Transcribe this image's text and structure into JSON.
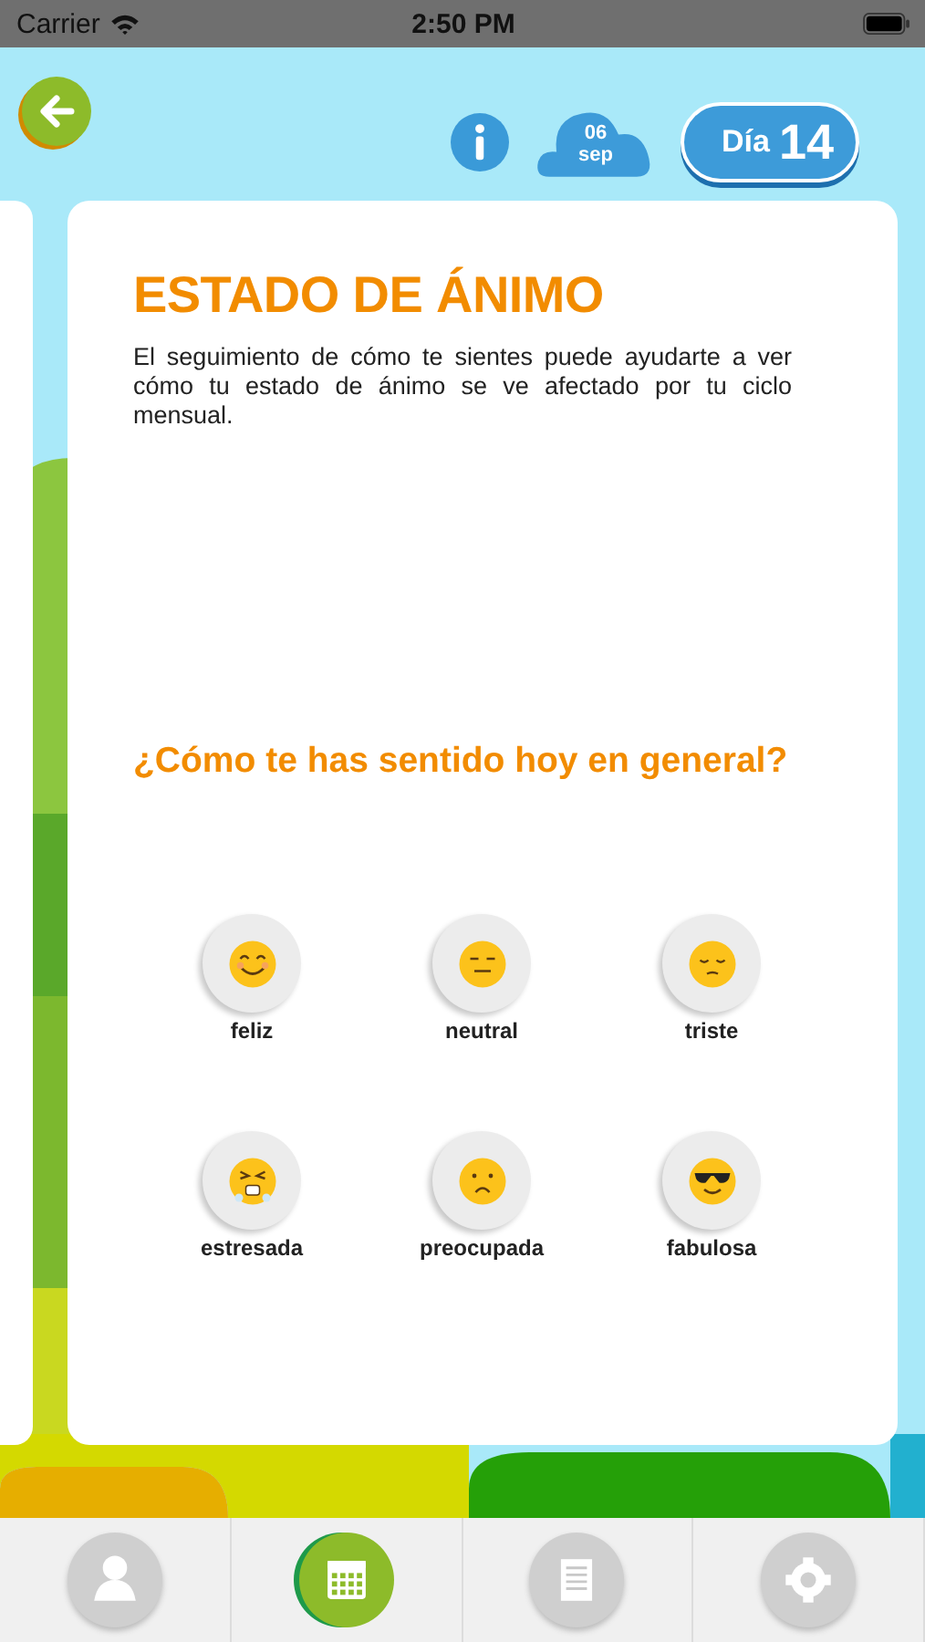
{
  "status_bar": {
    "carrier": "Carrier",
    "time": "2:50 PM"
  },
  "header": {
    "date_day": "06",
    "date_month": "sep",
    "day_label": "Día",
    "day_number": "14"
  },
  "card": {
    "title": "ESTADO DE ÁNIMO",
    "description": "El seguimiento de cómo te sientes puede ayudarte a ver cómo tu estado de ánimo se ve afectado por tu ciclo mensual.",
    "question": "¿Cómo te has sentido hoy en general?"
  },
  "moods": [
    {
      "kind": "happy",
      "label": "feliz"
    },
    {
      "kind": "neutral",
      "label": "neutral"
    },
    {
      "kind": "sad",
      "label": "triste"
    },
    {
      "kind": "stressed",
      "label": "estresada"
    },
    {
      "kind": "worried",
      "label": "preocupada"
    },
    {
      "kind": "cool",
      "label": "fabulosa"
    }
  ],
  "tabs": [
    {
      "kind": "profile",
      "selected": false
    },
    {
      "kind": "calendar",
      "selected": true
    },
    {
      "kind": "notes",
      "selected": false
    },
    {
      "kind": "settings",
      "selected": false
    }
  ]
}
